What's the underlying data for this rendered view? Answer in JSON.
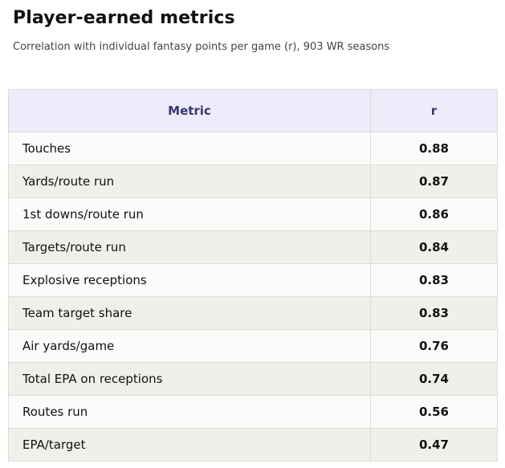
{
  "title": "Player-earned metrics",
  "subtitle": "Correlation with individual fantasy points per game (r), 903 WR seasons",
  "chart_data": {
    "type": "table",
    "columns": [
      "Metric",
      "r"
    ],
    "rows": [
      {
        "metric": "Touches",
        "r": "0.88"
      },
      {
        "metric": "Yards/route run",
        "r": "0.87"
      },
      {
        "metric": "1st downs/route run",
        "r": "0.86"
      },
      {
        "metric": "Targets/route run",
        "r": "0.84"
      },
      {
        "metric": "Explosive receptions",
        "r": "0.83"
      },
      {
        "metric": "Team target share",
        "r": "0.83"
      },
      {
        "metric": "Air yards/game",
        "r": "0.76"
      },
      {
        "metric": "Total EPA on receptions",
        "r": "0.74"
      },
      {
        "metric": "Routes run",
        "r": "0.56"
      },
      {
        "metric": "EPA/target",
        "r": "0.47"
      }
    ]
  }
}
